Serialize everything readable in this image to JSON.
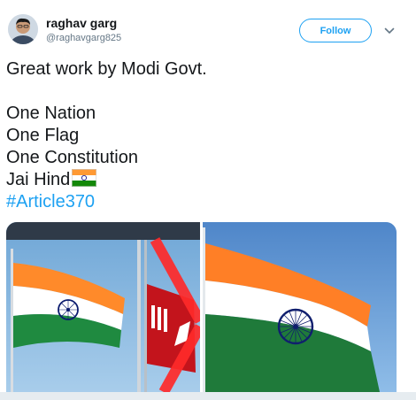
{
  "user": {
    "name": "raghav garg",
    "handle": "@raghavgarg825"
  },
  "actions": {
    "follow_label": "Follow",
    "menu_icon": "chevron-down-icon"
  },
  "tweet": {
    "lines": [
      "Great work by Modi Govt.",
      "",
      "One Nation",
      "One Flag",
      "One Constitution",
      "Jai Hind"
    ],
    "emoji": "indian-flag-emoji",
    "hashtag": "#Article370"
  },
  "media": {
    "left_image": "indian-flag-and-crossed-out-kashmir-flag",
    "right_image": "indian-flag-waving"
  },
  "colors": {
    "accent": "#1da1f2",
    "saffron": "#ff7f26",
    "green": "#1f7a3a",
    "chakra": "#1a237e",
    "cross": "#ff2020"
  }
}
